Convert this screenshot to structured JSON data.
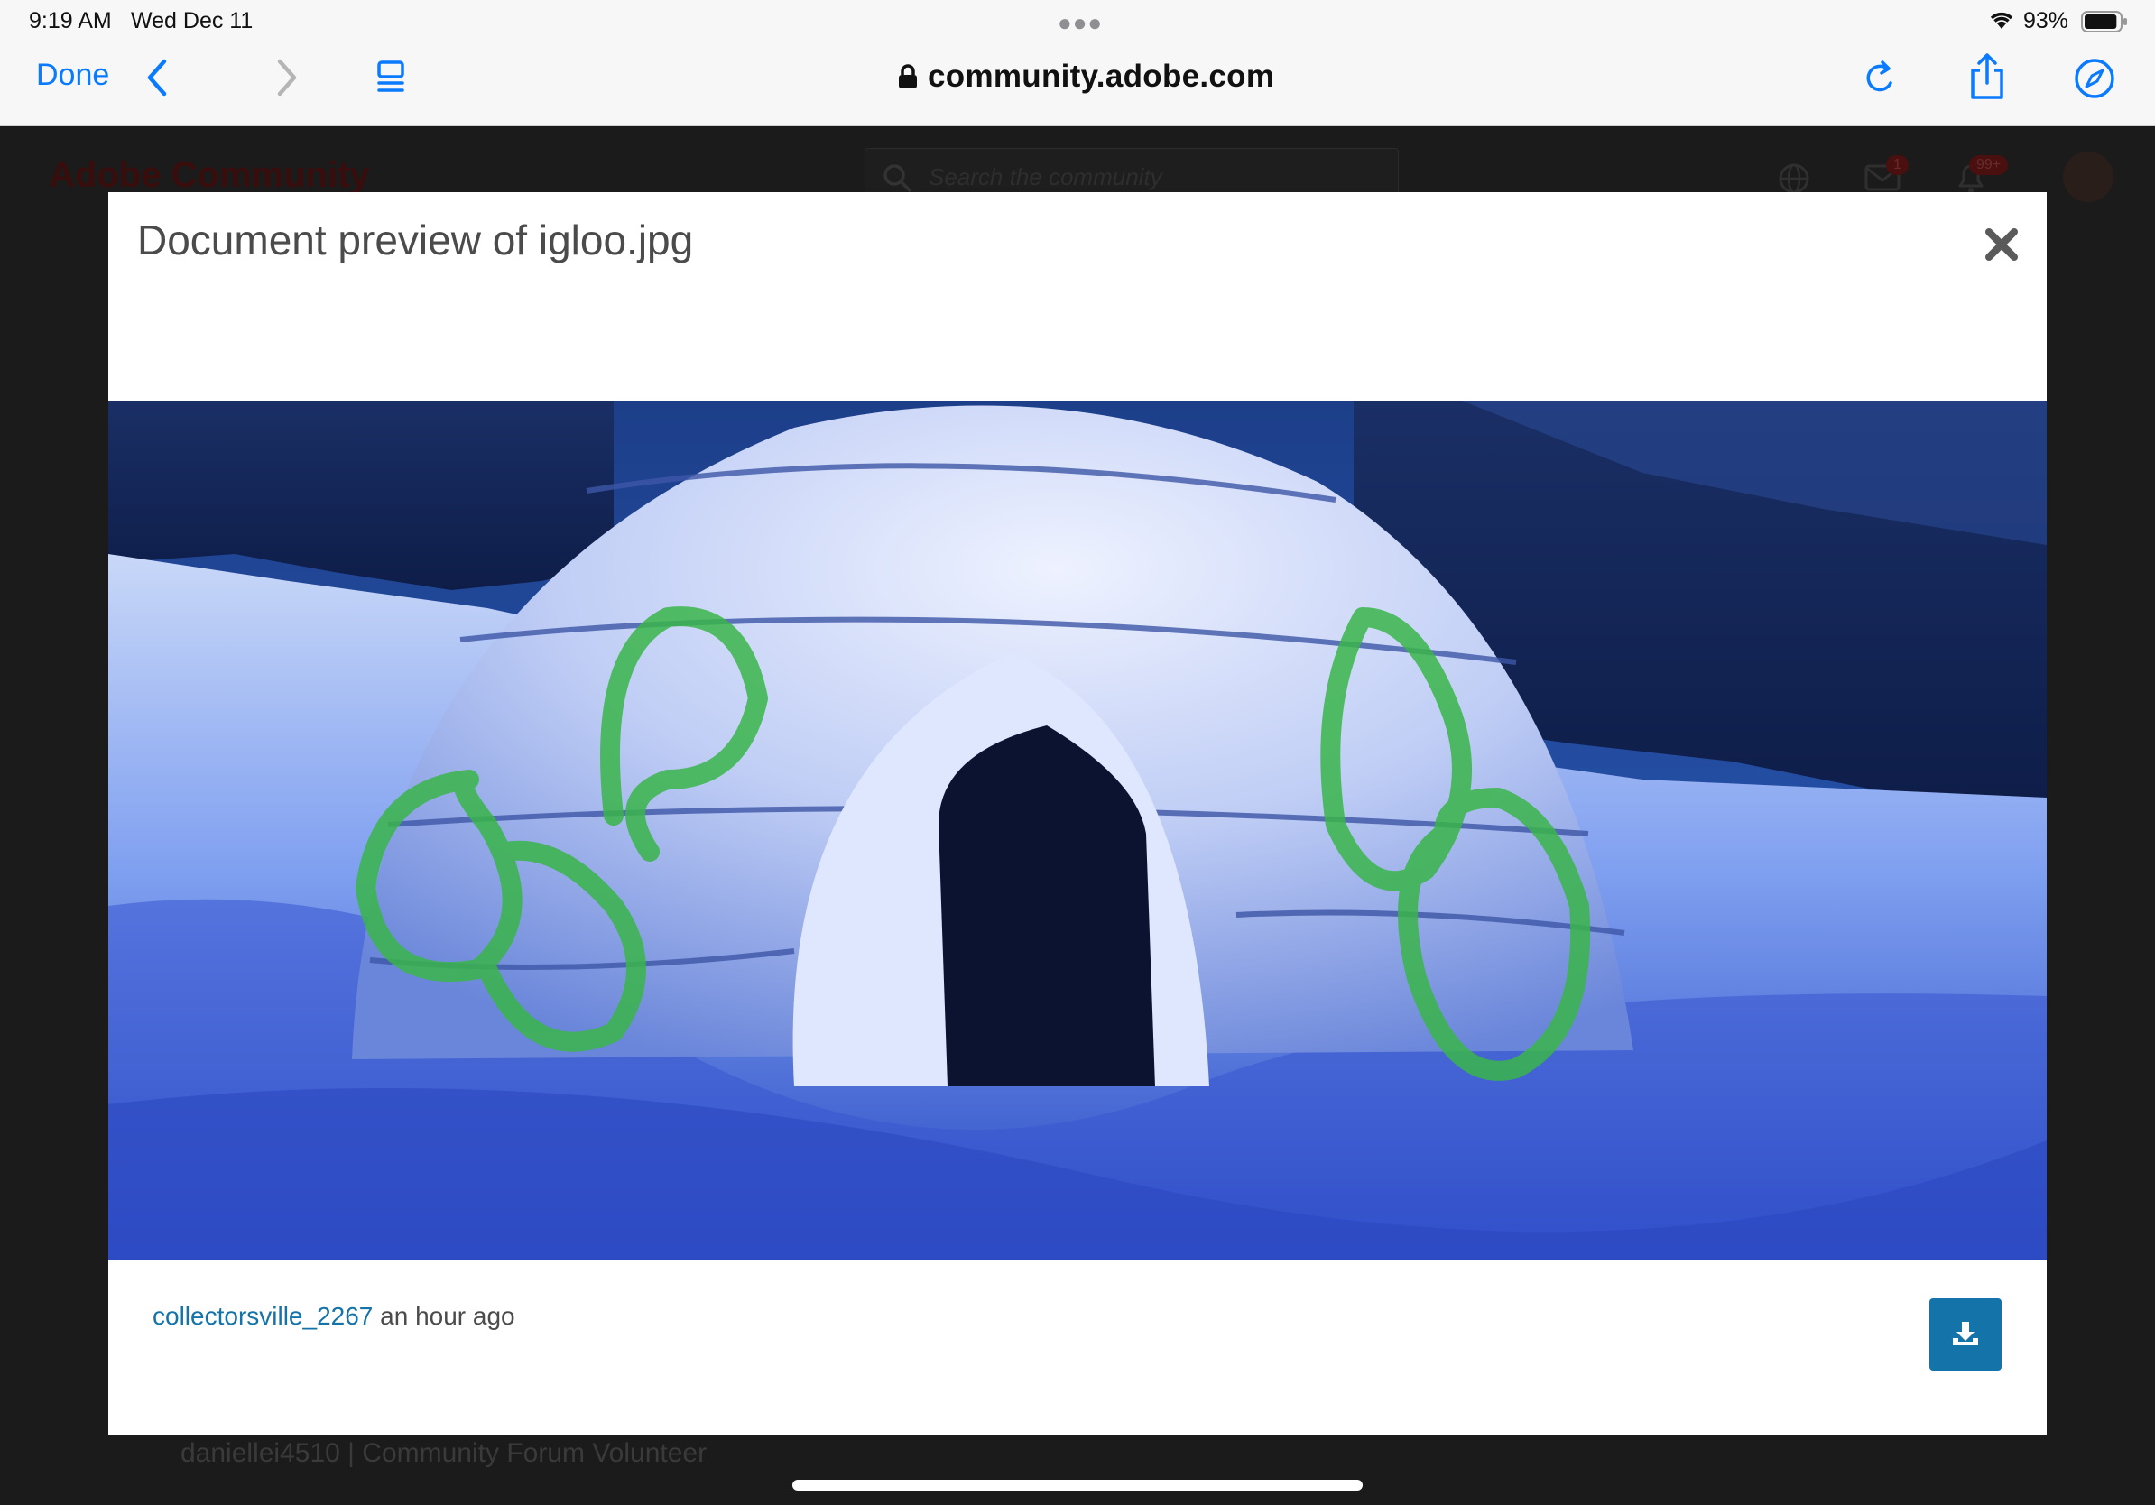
{
  "status_bar": {
    "time": "9:19 AM",
    "date": "Wed Dec 11",
    "battery_percent": "93%",
    "battery_level": 0.93
  },
  "browser": {
    "done_label": "Done",
    "url": "community.adobe.com",
    "icons": [
      "chevron-left-icon",
      "chevron-right-icon",
      "tabs-icon",
      "lock-icon",
      "reload-icon",
      "share-icon",
      "compass-icon"
    ],
    "accent_color": "#0a7aff"
  },
  "page_behind": {
    "logo_text": "Adobe Community",
    "search_placeholder": "Search the community",
    "messages_badge": "1",
    "notifications_badge": "99+",
    "footer_text": "daniellei4510 | Community Forum Volunteer"
  },
  "modal": {
    "title": "Document preview of igloo.jpg",
    "author": "collectorsville_2267",
    "timestamp": "an hour ago",
    "link_color": "#1473a8"
  }
}
